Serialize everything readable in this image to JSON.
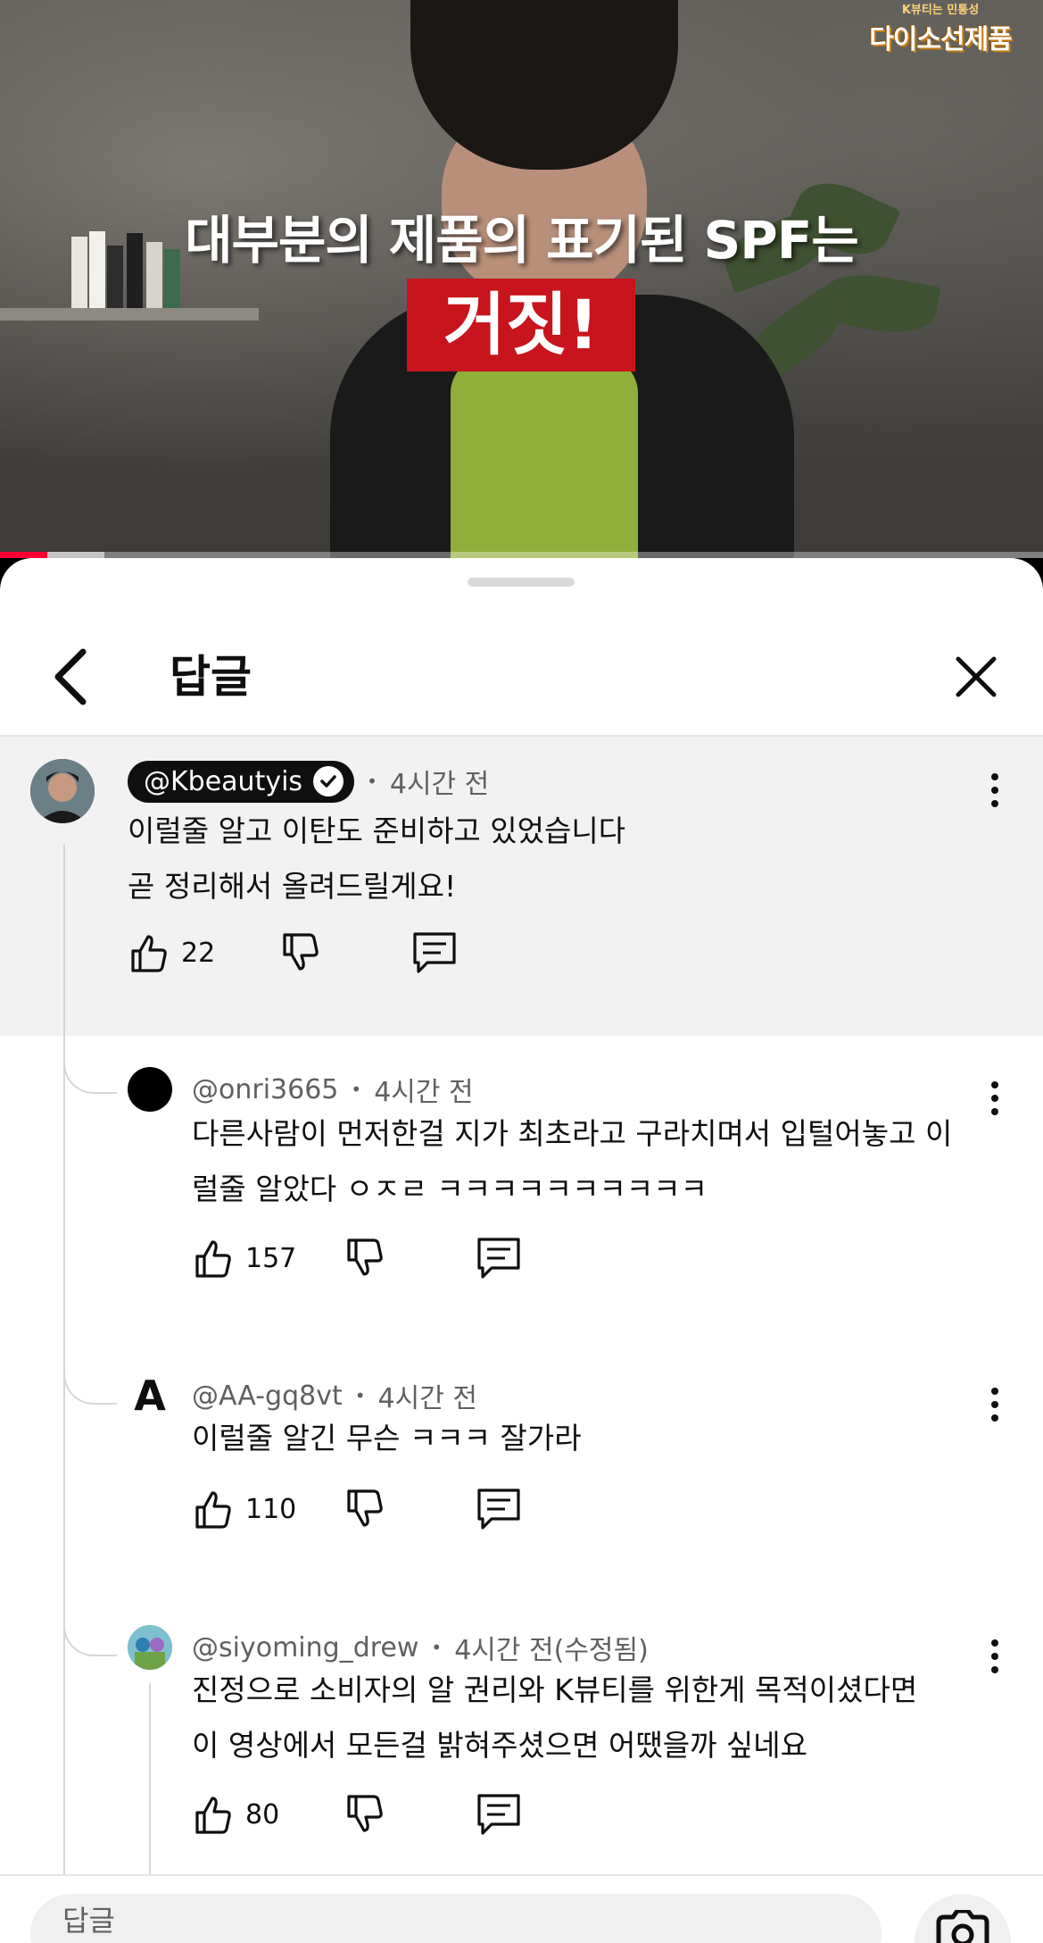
{
  "video": {
    "logo_tag": "K뷰티는 민통성",
    "logo_name": "다이소선제품",
    "caption_line1": "대부분의 제품의 표기된 SPF는",
    "caption_line2": "거짓!",
    "progress_fraction": 0.045,
    "buffer_fraction": 0.1
  },
  "sheet": {
    "title": "답글"
  },
  "comments": [
    {
      "handle": "@Kbeautyis",
      "verified": true,
      "time": "4시간 전",
      "lines": [
        "이럴줄 알고 이탄도 준비하고 있었습니다",
        "곧 정리해서 올려드릴게요!"
      ],
      "likes": "22"
    },
    {
      "handle": "@onri3665",
      "time": "4시간 전",
      "lines": [
        "다른사람이 먼저한걸 지가 최초라고 구라치며서 입털어놓고 이",
        "럴줄 알았다 ㅇㅈㄹ ㅋㅋㅋㅋㅋㅋㅋㅋㅋㅋ"
      ],
      "likes": "157"
    },
    {
      "handle": "@AA-gq8vt",
      "avatar_letter": "A",
      "time": "4시간 전",
      "lines": [
        "이럴줄 알긴 무슨 ㅋㅋㅋ 잘가라"
      ],
      "likes": "110"
    },
    {
      "handle": "@siyoming_drew",
      "time": "4시간 전(수정됨)",
      "lines": [
        "진정으로 소비자의 알 권리와 K뷰티를 위한게 목적이셨다면",
        "이 영상에서 모든걸 밝혀주셨으면 어땠을까 싶네요"
      ],
      "likes": "80"
    }
  ],
  "reply_input": {
    "placeholder": "답글"
  },
  "colors": {
    "progress_red": "#ff0033",
    "caption_red_box": "#c8141c",
    "highlight_bg": "#f2f2f2",
    "text_primary": "#0f0f0f",
    "text_secondary": "#606060"
  },
  "icons": [
    "back-arrow-icon",
    "close-icon",
    "verified-check-icon",
    "like-icon",
    "dislike-icon",
    "reply-icon",
    "more-vert-icon",
    "camera-icon"
  ]
}
